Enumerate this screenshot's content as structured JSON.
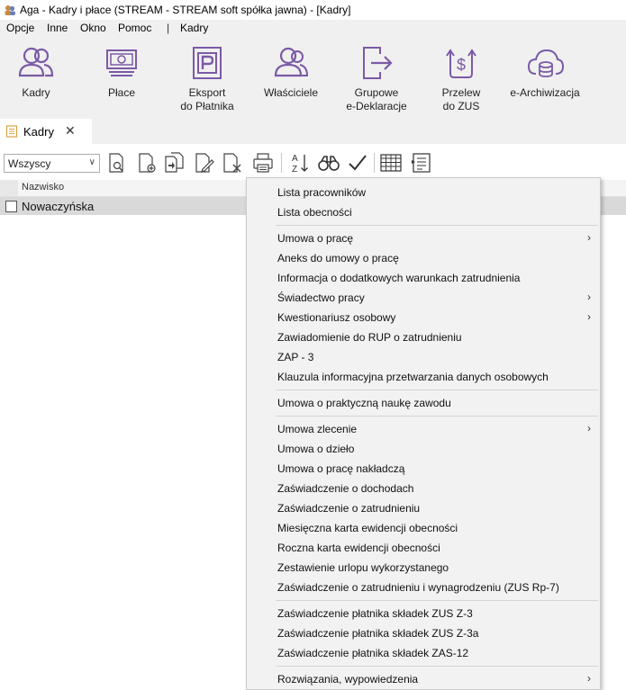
{
  "window": {
    "title": "Aga - Kadry i płace (STREAM - STREAM soft spółka jawna) - [Kadry]"
  },
  "menubar": {
    "items": [
      "Opcje",
      "Inne",
      "Okno",
      "Pomoc",
      "Kadry"
    ],
    "separator": "|"
  },
  "ribbon": {
    "buttons": [
      {
        "label": "Kadry",
        "icon": "people-icon"
      },
      {
        "label": "Płace",
        "icon": "money-icon"
      },
      {
        "label": "Eksport\ndo Płatnika",
        "icon": "platnik-p-icon"
      },
      {
        "label": "Właściciele",
        "icon": "owners-icon"
      },
      {
        "label": "Grupowe\ne-Deklaracje",
        "icon": "export-arrow-icon"
      },
      {
        "label": "Przelew\ndo ZUS",
        "icon": "dollar-transfer-icon"
      },
      {
        "label": "e-Archiwizacja",
        "icon": "cloud-database-icon"
      }
    ],
    "accent": "#7b5aa6"
  },
  "tab": {
    "label": "Kadry",
    "close": "✕"
  },
  "toolbar": {
    "filter_value": "Wszyscy",
    "sort_label": "A Z"
  },
  "grid": {
    "columns": [
      "Nazwisko"
    ],
    "rows": [
      {
        "nazwisko": "Nowaczyńska"
      }
    ]
  },
  "context_menu": {
    "items": [
      {
        "label": "Lista pracowników"
      },
      {
        "label": "Lista obecności"
      },
      {
        "label": "Umowa o pracę",
        "submenu": "›"
      },
      {
        "label": "Aneks do umowy o pracę"
      },
      {
        "label": "Informacja o dodatkowych warunkach zatrudnienia"
      },
      {
        "label": "Świadectwo pracy",
        "submenu": "›"
      },
      {
        "label": "Kwestionariusz osobowy",
        "submenu": "›"
      },
      {
        "label": "Zawiadomienie do RUP o zatrudnieniu"
      },
      {
        "label": "ZAP - 3"
      },
      {
        "label": "Klauzula informacyjna przetwarzania danych osobowych"
      },
      {
        "label": "Umowa o praktyczną naukę zawodu"
      },
      {
        "label": "Umowa zlecenie",
        "submenu": "›"
      },
      {
        "label": "Umowa o dzieło"
      },
      {
        "label": "Umowa o pracę nakładczą"
      },
      {
        "label": "Zaświadczenie o dochodach"
      },
      {
        "label": "Zaświadczenie o zatrudnieniu"
      },
      {
        "label": "Miesięczna karta ewidencji obecności"
      },
      {
        "label": "Roczna karta ewidencji obecności"
      },
      {
        "label": "Zestawienie urlopu wykorzystanego"
      },
      {
        "label": "Zaświadczenie o zatrudnieniu i wynagrodzeniu (ZUS Rp-7)"
      },
      {
        "label": "Zaświadczenie płatnika składek ZUS Z-3"
      },
      {
        "label": "Zaświadczenie płatnika składek ZUS Z-3a"
      },
      {
        "label": "Zaświadczenie płatnika składek ZAS-12"
      },
      {
        "label": "Rozwiązania, wypowiedzenia",
        "submenu": "›"
      }
    ]
  }
}
